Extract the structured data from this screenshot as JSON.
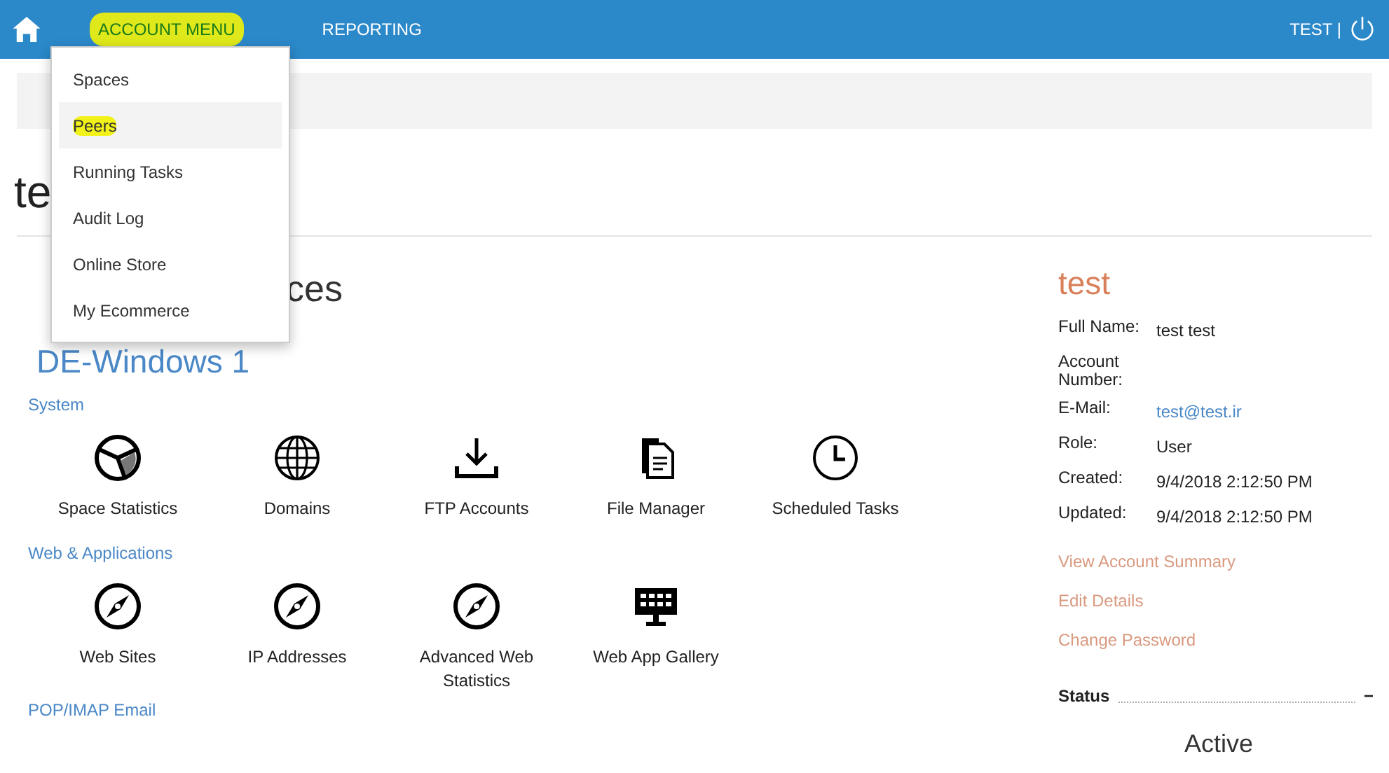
{
  "navbar": {
    "items": [
      {
        "label": "ACCOUNT MENU",
        "highlighted": true
      },
      {
        "label": "REPORTING",
        "highlighted": false
      }
    ],
    "user": "TEST |"
  },
  "account_menu": {
    "items": [
      {
        "label": "Spaces",
        "selected": false,
        "highlighted": false
      },
      {
        "label": "Peers",
        "selected": true,
        "highlighted": true
      },
      {
        "label": "Running Tasks",
        "selected": false,
        "highlighted": false
      },
      {
        "label": "Audit Log",
        "selected": false,
        "highlighted": false
      },
      {
        "label": "Online Store",
        "selected": false,
        "highlighted": false
      },
      {
        "label": "My Ecommerce",
        "selected": false,
        "highlighted": false
      }
    ]
  },
  "page_title": "te",
  "section_title": "ces",
  "space": {
    "name": "DE-Windows 1",
    "groups": [
      {
        "title": "System",
        "items": [
          {
            "label": "Space Statistics"
          },
          {
            "label": "Domains"
          },
          {
            "label": "FTP Accounts"
          },
          {
            "label": "File Manager"
          },
          {
            "label": "Scheduled Tasks"
          }
        ]
      },
      {
        "title": "Web & Applications",
        "items": [
          {
            "label": "Web Sites"
          },
          {
            "label": "IP Addresses"
          },
          {
            "label": "Advanced Web Statistics"
          },
          {
            "label": "Web App Gallery"
          }
        ]
      },
      {
        "title": "POP/IMAP Email"
      }
    ]
  },
  "user_panel": {
    "name": "test",
    "fields": [
      {
        "label": "Full Name:",
        "value": "test test",
        "kind": "text"
      },
      {
        "label": "Account Number:",
        "kind": "text"
      },
      {
        "label": "E-Mail:",
        "value": "test@test.ir",
        "kind": "link"
      },
      {
        "label": "Role:",
        "value": "User",
        "kind": "text"
      },
      {
        "label": "Created:",
        "value": "9/4/2018 2:12:50 PM",
        "kind": "text"
      },
      {
        "label": "Updated:",
        "value": "9/4/2018 2:12:50 PM",
        "kind": "text"
      }
    ],
    "links": [
      "View Account Summary",
      "Edit Details",
      "Change Password"
    ],
    "status": {
      "title": "Status",
      "toggle": "−",
      "value": "Active"
    }
  }
}
